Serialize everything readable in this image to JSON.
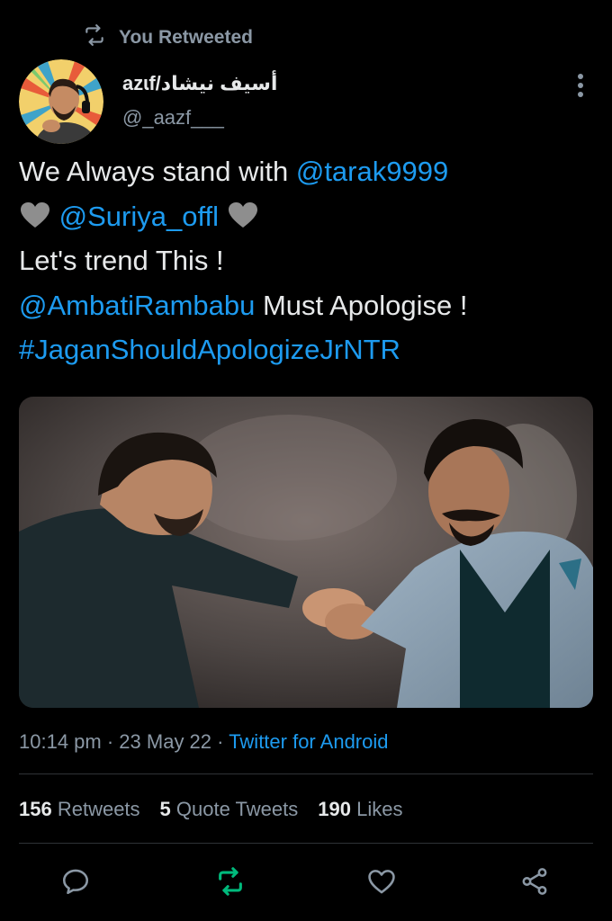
{
  "retweet_banner": {
    "icon": "retweet-icon",
    "label": "You Retweeted"
  },
  "author": {
    "display_name": "azɩf/أسيف نيشاد",
    "handle": "@_aazf___"
  },
  "tweet": {
    "lines": [
      {
        "text": "We Always stand with ",
        "mention": "@tarak9999"
      },
      {
        "heart1": "🩶",
        "mention": "@Suriya_offl",
        "heart2": "🩶"
      },
      {
        "text": "Let's trend This !"
      },
      {
        "mention": "@AmbatiRambabu",
        "text": " Must Apologise !"
      },
      {
        "hashtag": "#JaganShouldApologizeJrNTR"
      }
    ]
  },
  "meta": {
    "time": "10:14 pm",
    "sep1": " · ",
    "date": "23 May 22",
    "sep2": " · ",
    "source": "Twitter for Android"
  },
  "stats": {
    "retweets_count": "156",
    "retweets_label": " Retweets",
    "quotes_count": "5",
    "quotes_label": " Quote Tweets",
    "likes_count": "190",
    "likes_label": " Likes"
  },
  "actions": [
    {
      "name": "reply",
      "icon": "reply-icon"
    },
    {
      "name": "retweet",
      "icon": "retweet-icon",
      "active": true
    },
    {
      "name": "like",
      "icon": "heart-icon"
    },
    {
      "name": "share",
      "icon": "share-icon"
    }
  ],
  "colors": {
    "background": "#000000",
    "text": "#e7e9ea",
    "secondary": "#8b98a5",
    "link": "#1d9bf0",
    "retweet_active": "#00ba7c",
    "divider": "#2f3336"
  }
}
